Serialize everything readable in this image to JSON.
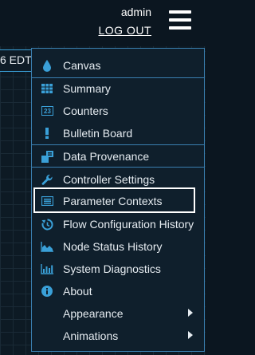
{
  "header": {
    "user": "admin",
    "logout_label": "LOG OUT"
  },
  "status": {
    "time_fragment": "6 EDT"
  },
  "menu": {
    "items": [
      {
        "label": "Canvas",
        "icon": "droplet-icon"
      },
      {
        "label": "Summary",
        "icon": "table-icon"
      },
      {
        "label": "Counters",
        "icon": "counter-icon"
      },
      {
        "label": "Bulletin Board",
        "icon": "exclamation-icon"
      },
      {
        "label": "Data Provenance",
        "icon": "provenance-icon"
      },
      {
        "label": "Controller Settings",
        "icon": "wrench-icon"
      },
      {
        "label": "Parameter Contexts",
        "icon": "list-box-icon"
      },
      {
        "label": "Flow Configuration History",
        "icon": "history-icon"
      },
      {
        "label": "Node Status History",
        "icon": "area-chart-icon"
      },
      {
        "label": "System Diagnostics",
        "icon": "bar-chart-icon"
      },
      {
        "label": "About",
        "icon": "info-icon"
      },
      {
        "label": "Appearance",
        "icon": ""
      },
      {
        "label": "Animations",
        "icon": ""
      }
    ],
    "highlighted": "Parameter Contexts"
  },
  "colors": {
    "accent": "#3aa0d8",
    "background": "#0b1620",
    "menu_bg": "#0f1f2c",
    "text": "#e6ecf1"
  }
}
